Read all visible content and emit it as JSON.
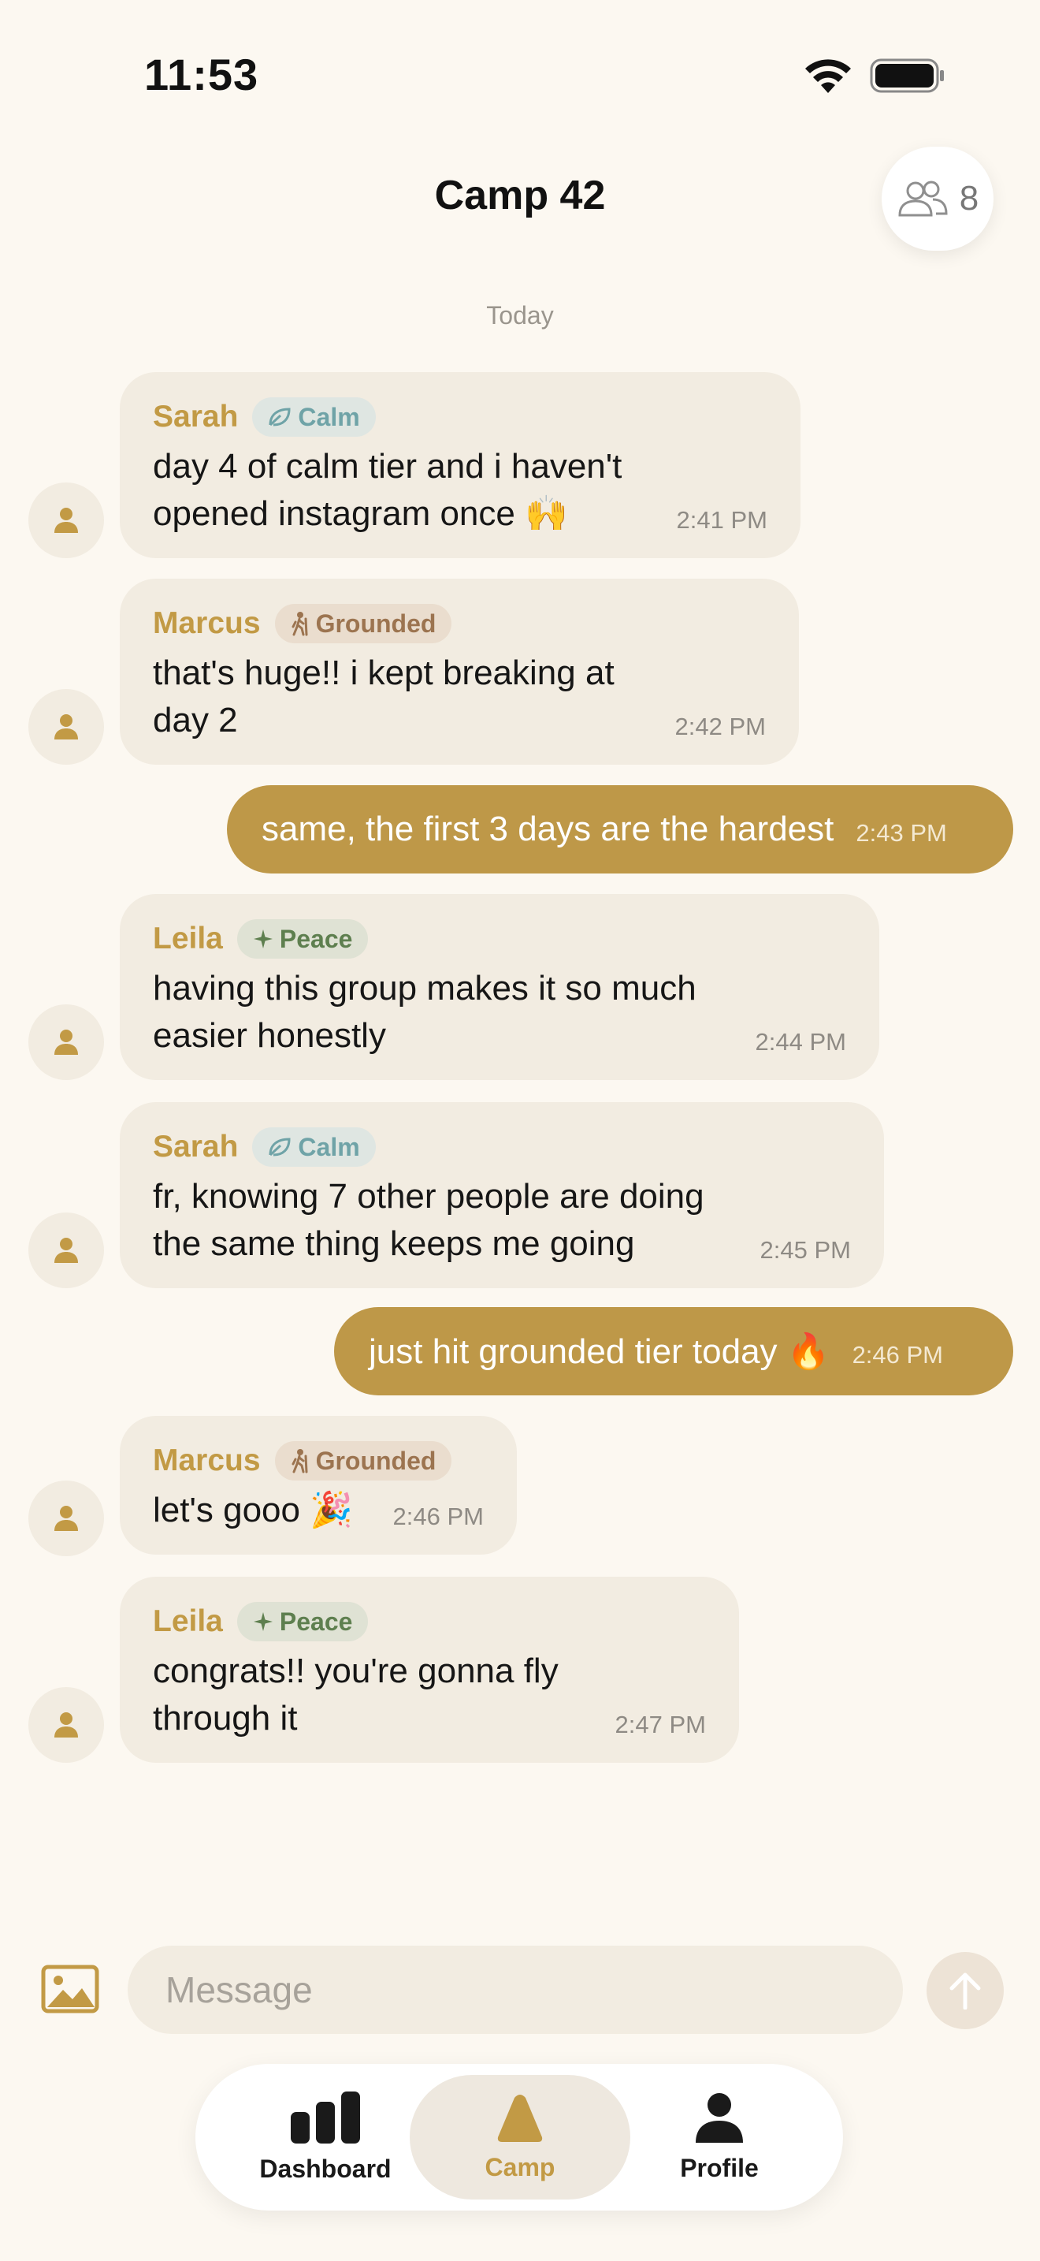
{
  "status_bar": {
    "time": "11:53"
  },
  "header": {
    "title": "Camp 42",
    "member_count": "8",
    "members_icon": "people-icon"
  },
  "date_divider": "Today",
  "messages": [
    {
      "sender": "Sarah",
      "tier": "Calm",
      "tier_icon": "leaf-icon",
      "lines": [
        "day 4 of calm tier and i haven't",
        "opened instagram once 🙌"
      ],
      "time": "2:41 PM"
    },
    {
      "sender": "Marcus",
      "tier": "Grounded",
      "tier_icon": "hiker-icon",
      "lines": [
        "that's huge!! i kept breaking at",
        "day 2"
      ],
      "time": "2:42 PM"
    },
    {
      "outgoing": true,
      "text": "same, the first 3 days are the hardest",
      "time": "2:43 PM"
    },
    {
      "sender": "Leila",
      "tier": "Peace",
      "tier_icon": "sparkle-icon",
      "lines": [
        "having this group makes it so much",
        "easier honestly"
      ],
      "time": "2:44 PM"
    },
    {
      "sender": "Sarah",
      "tier": "Calm",
      "tier_icon": "leaf-icon",
      "lines": [
        "fr, knowing 7 other people are doing",
        "the same thing keeps me going"
      ],
      "time": "2:45 PM"
    },
    {
      "outgoing": true,
      "text": "just hit grounded tier today 🔥",
      "time": "2:46 PM"
    },
    {
      "sender": "Marcus",
      "tier": "Grounded",
      "tier_icon": "hiker-icon",
      "lines": [
        "let's gooo 🎉"
      ],
      "time": "2:46 PM"
    },
    {
      "sender": "Leila",
      "tier": "Peace",
      "tier_icon": "sparkle-icon",
      "lines": [
        "congrats!! you're gonna fly",
        "through it"
      ],
      "time": "2:47 PM"
    }
  ],
  "composer": {
    "placeholder": "Message"
  },
  "tabs": [
    {
      "label": "Dashboard",
      "icon": "bar-chart-icon",
      "active": false
    },
    {
      "label": "Camp",
      "icon": "tent-icon",
      "active": true
    },
    {
      "label": "Profile",
      "icon": "person-icon",
      "active": false
    }
  ],
  "colors": {
    "accent": "#BE9848",
    "background": "#FCF8F1",
    "bubble": "#F2ECE1",
    "calm": "#6FA3A7",
    "grounded": "#9C7450",
    "peace": "#5E7F4F"
  }
}
